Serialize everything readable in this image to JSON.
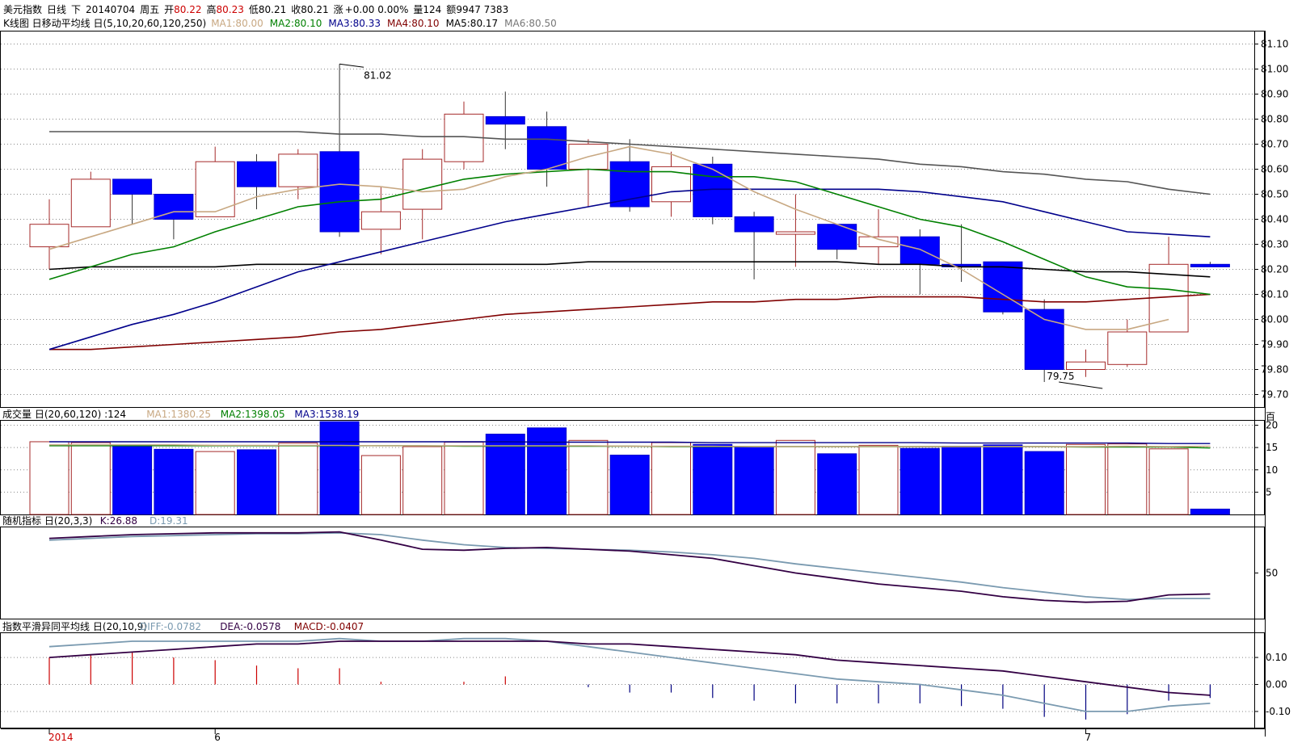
{
  "header": {
    "symbol": "美元指数",
    "period": "日线",
    "dir": "下",
    "date": "20140704",
    "weekday": "周五",
    "open_label": "开",
    "open": "80.22",
    "high_label": "高",
    "high": "80.23",
    "low_label": "低",
    "low": "80.21",
    "close_label": "收",
    "close": "80.21",
    "change_label": "涨",
    "change": "+0.00 0.00%",
    "volume_label": "量",
    "volume": "124",
    "amount_label": "额",
    "amount": "9947 7383"
  },
  "colors": {
    "up": "#a52a2a",
    "down": "#0000ff",
    "red_text": "#cc0000",
    "ma1": "#c8a882",
    "ma2": "#008000",
    "ma3": "#00008b",
    "ma4": "#800000",
    "ma5": "#000000",
    "ma6": "#555555",
    "k": "#330044",
    "d": "#7a9ab0",
    "diff": "#7a9ab0",
    "dea": "#330044",
    "macd_pos": "#cc0000",
    "macd_neg": "#000080"
  },
  "panels": {
    "kline": {
      "title": "K线图 日移动平均线 日(5,10,20,60,120,250)",
      "ma_legend": [
        {
          "label": "MA1:80.00",
          "color": "#c8a882"
        },
        {
          "label": "MA2:80.10",
          "color": "#008000"
        },
        {
          "label": "MA3:80.33",
          "color": "#00008b"
        },
        {
          "label": "MA4:80.10",
          "color": "#800000"
        },
        {
          "label": "MA5:80.17",
          "color": "#000000"
        },
        {
          "label": "MA6:80.50",
          "color": "#777777"
        }
      ],
      "high_annotation": "81.02",
      "low_annotation": "79.75"
    },
    "volume": {
      "title": "成交量 日(20,60,120) :124",
      "legend": [
        {
          "label": "MA1:1380.25",
          "color": "#c8a882"
        },
        {
          "label": "MA2:1398.05",
          "color": "#008000"
        },
        {
          "label": "MA3:1538.19",
          "color": "#00008b"
        }
      ],
      "unit": "百"
    },
    "kdj": {
      "title": "随机指标 日(20,3,3)",
      "legend": [
        {
          "label": "K:26.88",
          "color": "#330044"
        },
        {
          "label": "D:19.31",
          "color": "#7a9ab0"
        }
      ]
    },
    "macd": {
      "title": "指数平滑异同平均线 日(20,10,9)",
      "legend": [
        {
          "label": "DIFF:-0.0782",
          "color": "#7a9ab0"
        },
        {
          "label": "DEA:-0.0578",
          "color": "#330044"
        },
        {
          "label": "MACD:-0.0407",
          "color": "#800000"
        }
      ]
    }
  },
  "x_labels": [
    {
      "label": "2014",
      "index": 0,
      "color": "#cc0000"
    },
    {
      "label": "6",
      "index": 4,
      "color": "#000000"
    },
    {
      "label": "7",
      "index": 25,
      "color": "#000000"
    }
  ],
  "chart_data": {
    "type": "candlestick",
    "price": {
      "ylim": [
        79.65,
        81.15
      ],
      "ticks": [
        81.1,
        81.0,
        80.9,
        80.8,
        80.7,
        80.6,
        80.5,
        80.4,
        80.3,
        80.2,
        80.1,
        80.0,
        79.9,
        79.8,
        79.7
      ],
      "ohlc": [
        [
          80.29,
          80.48,
          80.2,
          80.38
        ],
        [
          80.37,
          80.59,
          80.37,
          80.56
        ],
        [
          80.56,
          80.56,
          80.38,
          80.5
        ],
        [
          80.5,
          80.5,
          80.32,
          80.4
        ],
        [
          80.41,
          80.69,
          80.41,
          80.63
        ],
        [
          80.63,
          80.66,
          80.44,
          80.53
        ],
        [
          80.53,
          80.68,
          80.48,
          80.66
        ],
        [
          80.67,
          81.02,
          80.33,
          80.35
        ],
        [
          80.36,
          80.53,
          80.26,
          80.43
        ],
        [
          80.44,
          80.68,
          80.32,
          80.64
        ],
        [
          80.63,
          80.87,
          80.6,
          80.82
        ],
        [
          80.81,
          80.91,
          80.68,
          80.78
        ],
        [
          80.77,
          80.83,
          80.53,
          80.6
        ],
        [
          80.6,
          80.72,
          80.45,
          80.7
        ],
        [
          80.63,
          80.72,
          80.43,
          80.45
        ],
        [
          80.47,
          80.67,
          80.41,
          80.61
        ],
        [
          80.62,
          80.65,
          80.38,
          80.41
        ],
        [
          80.41,
          80.43,
          80.16,
          80.35
        ],
        [
          80.34,
          80.5,
          80.21,
          80.35
        ],
        [
          80.38,
          80.38,
          80.24,
          80.28
        ],
        [
          80.29,
          80.44,
          80.22,
          80.33
        ],
        [
          80.33,
          80.36,
          80.1,
          80.22
        ],
        [
          80.22,
          80.38,
          80.15,
          80.21
        ],
        [
          80.23,
          80.23,
          80.02,
          80.03
        ],
        [
          80.04,
          80.08,
          79.75,
          79.8
        ],
        [
          79.8,
          79.88,
          79.77,
          79.83
        ],
        [
          79.82,
          80.0,
          79.81,
          79.95
        ],
        [
          79.95,
          80.33,
          79.95,
          80.22
        ],
        [
          80.22,
          80.23,
          80.21,
          80.21
        ]
      ],
      "ma1": [
        80.28,
        80.33,
        80.38,
        80.43,
        80.43,
        80.49,
        80.52,
        80.54,
        80.53,
        80.51,
        80.52,
        80.57,
        80.6,
        80.65,
        80.69,
        80.66,
        80.6,
        80.51,
        80.44,
        80.38,
        80.32,
        80.28,
        80.2,
        80.1,
        80.0,
        79.96,
        79.96,
        80.0
      ],
      "ma2": [
        80.16,
        80.21,
        80.26,
        80.29,
        80.35,
        80.4,
        80.45,
        80.47,
        80.48,
        80.52,
        80.56,
        80.58,
        80.59,
        80.6,
        80.59,
        80.59,
        80.57,
        80.57,
        80.55,
        80.5,
        80.45,
        80.4,
        80.37,
        80.31,
        80.24,
        80.17,
        80.13,
        80.12,
        80.1
      ],
      "ma3": [
        79.88,
        79.93,
        79.98,
        80.02,
        80.07,
        80.13,
        80.19,
        80.23,
        80.27,
        80.31,
        80.35,
        80.39,
        80.42,
        80.45,
        80.48,
        80.51,
        80.52,
        80.52,
        80.52,
        80.52,
        80.52,
        80.51,
        80.49,
        80.47,
        80.43,
        80.39,
        80.35,
        80.34,
        80.33
      ],
      "ma4": [
        79.88,
        79.88,
        79.89,
        79.9,
        79.91,
        79.92,
        79.93,
        79.95,
        79.96,
        79.98,
        80.0,
        80.02,
        80.03,
        80.04,
        80.05,
        80.06,
        80.07,
        80.07,
        80.08,
        80.08,
        80.09,
        80.09,
        80.09,
        80.08,
        80.07,
        80.07,
        80.08,
        80.09,
        80.1
      ],
      "ma5": [
        80.2,
        80.21,
        80.21,
        80.21,
        80.21,
        80.22,
        80.22,
        80.22,
        80.22,
        80.22,
        80.22,
        80.22,
        80.22,
        80.23,
        80.23,
        80.23,
        80.23,
        80.23,
        80.23,
        80.23,
        80.22,
        80.22,
        80.21,
        80.21,
        80.2,
        80.19,
        80.19,
        80.18,
        80.17
      ],
      "ma6": [
        80.75,
        80.75,
        80.75,
        80.75,
        80.75,
        80.75,
        80.75,
        80.74,
        80.74,
        80.73,
        80.73,
        80.72,
        80.72,
        80.71,
        80.7,
        80.69,
        80.68,
        80.67,
        80.66,
        80.65,
        80.64,
        80.62,
        80.61,
        80.59,
        80.58,
        80.56,
        80.55,
        80.52,
        80.5
      ]
    },
    "volume": {
      "ylim": [
        0,
        21
      ],
      "ticks": [
        20,
        15,
        10,
        5
      ],
      "values": [
        16.3,
        16.1,
        15.5,
        14.6,
        14.1,
        14.5,
        16.0,
        20.8,
        13.2,
        15.2,
        16.2,
        18.0,
        19.4,
        16.6,
        13.3,
        16.1,
        15.7,
        15.2,
        16.6,
        13.6,
        15.5,
        14.8,
        15.3,
        15.6,
        14.1,
        15.7,
        15.8,
        14.7,
        1.2
      ],
      "ma1": [
        15.6,
        15.6,
        15.6,
        15.6,
        15.5,
        15.5,
        15.5,
        15.5,
        15.4,
        15.4,
        15.4,
        15.4,
        15.4,
        15.4,
        15.3,
        15.3,
        15.3,
        15.2,
        15.2,
        15.2,
        15.2,
        15.2,
        15.2,
        15.2,
        15.2,
        15.2,
        15.3,
        15.2,
        15.3
      ],
      "ma2": [
        15.4,
        15.4,
        15.4,
        15.4,
        15.4,
        15.4,
        15.4,
        15.4,
        15.4,
        15.4,
        15.3,
        15.3,
        15.3,
        15.3,
        15.3,
        15.2,
        15.2,
        15.2,
        15.2,
        15.2,
        15.2,
        15.2,
        15.2,
        15.2,
        15.2,
        15.1,
        15.1,
        15.1,
        14.9
      ],
      "ma3": [
        16.3,
        16.3,
        16.3,
        16.3,
        16.3,
        16.3,
        16.3,
        16.3,
        16.3,
        16.3,
        16.3,
        16.3,
        16.2,
        16.2,
        16.2,
        16.2,
        16.1,
        16.1,
        16.1,
        16.1,
        16.1,
        16.1,
        16.0,
        16.0,
        16.0,
        16.0,
        16.0,
        15.9,
        15.9
      ]
    },
    "kdj": {
      "ylim": [
        0,
        100
      ],
      "ticks": [
        50
      ],
      "k": [
        88,
        90,
        92,
        93,
        94,
        94,
        94,
        95,
        86,
        76,
        75,
        77,
        78,
        76,
        74,
        70,
        66,
        58,
        50,
        44,
        38,
        34,
        30,
        24,
        20,
        18,
        19,
        26,
        27
      ],
      "d": [
        86,
        88,
        90,
        91,
        92,
        93,
        93,
        94,
        92,
        86,
        81,
        78,
        77,
        76,
        75,
        73,
        70,
        66,
        60,
        55,
        50,
        45,
        40,
        34,
        29,
        24,
        21,
        22,
        22
      ]
    },
    "macd": {
      "ylim": [
        -0.16,
        0.19
      ],
      "ticks": [
        0.1,
        0.0,
        -0.1
      ],
      "diff": [
        0.14,
        0.15,
        0.16,
        0.16,
        0.16,
        0.16,
        0.16,
        0.17,
        0.16,
        0.16,
        0.17,
        0.17,
        0.16,
        0.14,
        0.12,
        0.1,
        0.08,
        0.06,
        0.04,
        0.02,
        0.01,
        0.0,
        -0.02,
        -0.04,
        -0.07,
        -0.1,
        -0.1,
        -0.08,
        -0.07
      ],
      "dea": [
        0.1,
        0.11,
        0.12,
        0.13,
        0.14,
        0.15,
        0.15,
        0.16,
        0.16,
        0.16,
        0.16,
        0.16,
        0.16,
        0.15,
        0.15,
        0.14,
        0.13,
        0.12,
        0.11,
        0.09,
        0.08,
        0.07,
        0.06,
        0.05,
        0.03,
        0.01,
        -0.01,
        -0.03,
        -0.04
      ],
      "hist": [
        0.1,
        0.11,
        0.12,
        0.1,
        0.09,
        0.07,
        0.06,
        0.06,
        0.01,
        0.0,
        0.01,
        0.03,
        0.0,
        -0.01,
        -0.03,
        -0.03,
        -0.05,
        -0.06,
        -0.07,
        -0.07,
        -0.07,
        -0.07,
        -0.08,
        -0.09,
        -0.12,
        -0.13,
        -0.11,
        -0.06,
        -0.05
      ]
    }
  }
}
